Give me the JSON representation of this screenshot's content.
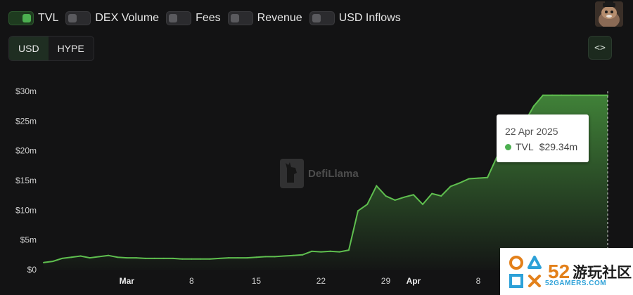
{
  "toggles": [
    {
      "label": "TVL",
      "on": true
    },
    {
      "label": "DEX Volume",
      "on": false
    },
    {
      "label": "Fees",
      "on": false
    },
    {
      "label": "Revenue",
      "on": false
    },
    {
      "label": "USD Inflows",
      "on": false
    }
  ],
  "currency": {
    "options": [
      "USD",
      "HYPE"
    ],
    "selected": "USD"
  },
  "embed_button": {
    "label": "<>"
  },
  "watermark": {
    "text": "DefiLlama"
  },
  "tooltip": {
    "date": "22 Apr 2025",
    "series": "TVL",
    "value": "$29.34m",
    "dot_color": "#4caf50"
  },
  "badge": {
    "number": "52",
    "name": "游玩社区",
    "site": "52GAMERS.COM"
  },
  "colors": {
    "accent": "#4caf50",
    "line": "#5fbf4f",
    "background": "#131314"
  },
  "chart_data": {
    "type": "area",
    "series": [
      {
        "name": "TVL"
      }
    ],
    "yticks": [
      "$0",
      "$5m",
      "$10m",
      "$15m",
      "$20m",
      "$25m",
      "$30m"
    ],
    "ylim": [
      0,
      30
    ],
    "yunit": "$m",
    "xticks": [
      {
        "label": "Mar",
        "date": "2025-03-01",
        "major": true
      },
      {
        "label": "8",
        "date": "2025-03-08",
        "major": false
      },
      {
        "label": "15",
        "date": "2025-03-15",
        "major": false
      },
      {
        "label": "22",
        "date": "2025-03-22",
        "major": false
      },
      {
        "label": "29",
        "date": "2025-03-29",
        "major": false
      },
      {
        "label": "Apr",
        "date": "2025-04-01",
        "major": true
      },
      {
        "label": "8",
        "date": "2025-04-08",
        "major": false
      }
    ],
    "x": [
      "2025-02-20",
      "2025-02-21",
      "2025-02-22",
      "2025-02-23",
      "2025-02-24",
      "2025-02-25",
      "2025-02-26",
      "2025-02-27",
      "2025-02-28",
      "2025-03-01",
      "2025-03-02",
      "2025-03-03",
      "2025-03-04",
      "2025-03-05",
      "2025-03-06",
      "2025-03-07",
      "2025-03-08",
      "2025-03-09",
      "2025-03-10",
      "2025-03-11",
      "2025-03-12",
      "2025-03-13",
      "2025-03-14",
      "2025-03-15",
      "2025-03-16",
      "2025-03-17",
      "2025-03-18",
      "2025-03-19",
      "2025-03-20",
      "2025-03-21",
      "2025-03-22",
      "2025-03-23",
      "2025-03-24",
      "2025-03-25",
      "2025-03-26",
      "2025-03-27",
      "2025-03-28",
      "2025-03-29",
      "2025-03-30",
      "2025-03-31",
      "2025-04-01",
      "2025-04-02",
      "2025-04-03",
      "2025-04-04",
      "2025-04-05",
      "2025-04-06",
      "2025-04-07",
      "2025-04-08",
      "2025-04-09",
      "2025-04-10",
      "2025-04-11",
      "2025-04-12",
      "2025-04-13",
      "2025-04-14",
      "2025-04-15",
      "2025-04-16",
      "2025-04-17",
      "2025-04-18",
      "2025-04-19",
      "2025-04-20",
      "2025-04-21",
      "2025-04-22"
    ],
    "values": [
      1.2,
      1.4,
      1.9,
      2.1,
      2.3,
      2.0,
      2.2,
      2.4,
      2.1,
      2.0,
      2.0,
      1.9,
      1.9,
      1.9,
      1.9,
      1.8,
      1.8,
      1.8,
      1.8,
      1.9,
      2.0,
      2.0,
      2.0,
      2.1,
      2.2,
      2.2,
      2.3,
      2.4,
      2.5,
      3.1,
      3.0,
      3.1,
      3.0,
      3.3,
      9.9,
      11.0,
      14.1,
      12.4,
      11.7,
      12.2,
      12.6,
      11.0,
      12.8,
      12.4,
      14.0,
      14.6,
      15.3,
      15.4,
      15.5,
      18.9,
      21.5,
      23.0,
      24.8,
      27.5,
      29.34,
      29.34,
      29.34,
      29.34,
      29.34,
      29.34,
      29.34,
      29.34
    ],
    "grid": false,
    "crosshair_date": "2025-04-22"
  }
}
